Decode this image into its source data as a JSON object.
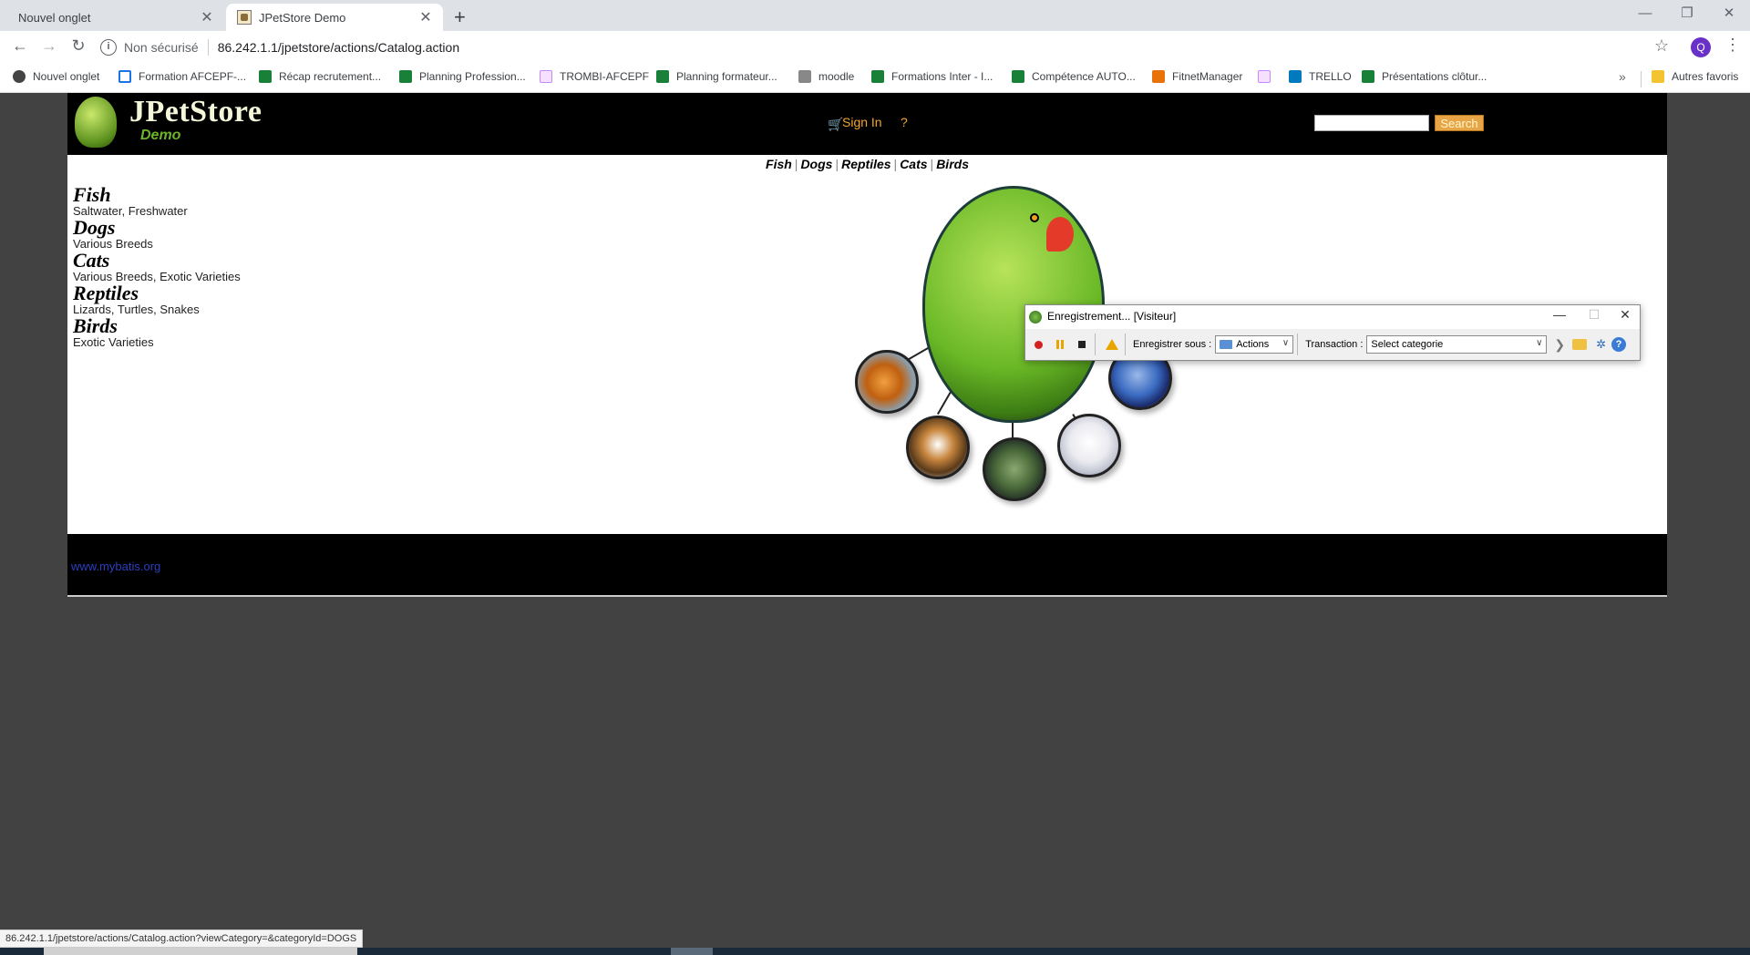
{
  "browser": {
    "tabs": [
      {
        "title": "Nouvel onglet",
        "active": false
      },
      {
        "title": "JPetStore Demo",
        "active": true
      }
    ],
    "new_tab_label": "+",
    "omnibox": {
      "security_text": "Non sécurisé",
      "url": "86.242.1.1/jpetstore/actions/Catalog.action"
    },
    "bookmarks": [
      {
        "label": "Nouvel onglet",
        "icon": "globe-icon",
        "color": "#444444"
      },
      {
        "label": "Formation AFCEPF-...",
        "icon": "doc-icon",
        "color": "#1a73e8"
      },
      {
        "label": "Récap recrutement...",
        "icon": "sheets-icon",
        "color": "#188038"
      },
      {
        "label": "Planning Profession...",
        "icon": "sheets-icon",
        "color": "#188038"
      },
      {
        "label": "TROMBI-AFCEPF",
        "icon": "link-icon",
        "color": "#c58af9"
      },
      {
        "label": "Planning formateur...",
        "icon": "sheets-icon",
        "color": "#188038"
      },
      {
        "label": "moodle",
        "icon": "moodle-icon",
        "color": "#888888"
      },
      {
        "label": "Formations Inter - I...",
        "icon": "sheets-icon",
        "color": "#188038"
      },
      {
        "label": "Compétence AUTO...",
        "icon": "sheets-icon",
        "color": "#188038"
      },
      {
        "label": "FitnetManager",
        "icon": "fitnet-icon",
        "color": "#e8710a"
      },
      {
        "label": "",
        "icon": "link-icon",
        "color": "#c58af9"
      },
      {
        "label": "TRELLO",
        "icon": "trello-icon",
        "color": "#0079bf"
      },
      {
        "label": "Présentations clôtur...",
        "icon": "sheets-icon",
        "color": "#188038"
      }
    ],
    "other_bookmarks": "Autres favoris",
    "profile_initial": "Q",
    "status_url": "86.242.1.1/jpetstore/actions/Catalog.action?viewCategory=&categoryId=DOGS"
  },
  "site": {
    "logo_title": "JPetStore",
    "logo_subtitle": "Demo",
    "sign_in": "Sign In",
    "help": "?",
    "search_button": "Search",
    "search_value": "",
    "quicklinks": [
      "Fish",
      "Dogs",
      "Reptiles",
      "Cats",
      "Birds"
    ],
    "categories": [
      {
        "name": "Fish",
        "desc": "Saltwater, Freshwater"
      },
      {
        "name": "Dogs",
        "desc": "Various Breeds"
      },
      {
        "name": "Cats",
        "desc": "Various Breeds, Exotic Varieties"
      },
      {
        "name": "Reptiles",
        "desc": "Lizards, Turtles, Snakes"
      },
      {
        "name": "Birds",
        "desc": "Exotic Varieties"
      }
    ],
    "footer_link": "www.mybatis.org"
  },
  "recorder": {
    "title": "Enregistrement... [Visiteur]",
    "save_as_label": "Enregistrer sous :",
    "save_as_value": "Actions",
    "transaction_label": "Transaction :",
    "transaction_value": "Select categorie"
  },
  "colors": {
    "header_bg": "#000000",
    "link_orange": "#f3a72b",
    "logo_green": "#6db32a"
  }
}
